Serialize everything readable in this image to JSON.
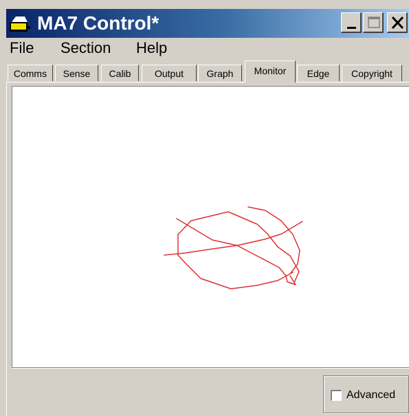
{
  "window": {
    "title": "MA7 Control*",
    "icon": "app-icon",
    "buttons": {
      "minimize": "minimize-icon",
      "maximize": "maximize-icon",
      "close": "close-icon"
    }
  },
  "menu": [
    "File",
    "Section",
    "Help"
  ],
  "tabs": [
    "Comms",
    "Sense",
    "Calib",
    "Output",
    "Graph",
    "Monitor",
    "Edge",
    "Copyright"
  ],
  "active_tab": "Monitor",
  "monitor": {
    "trace_color": "#e03030",
    "background": "#ffffff"
  },
  "advanced": {
    "label": "Advanced",
    "checked": false
  },
  "colors": {
    "title_start": "#0a246a",
    "title_end": "#a6caf0",
    "chrome": "#d4d0c8"
  }
}
